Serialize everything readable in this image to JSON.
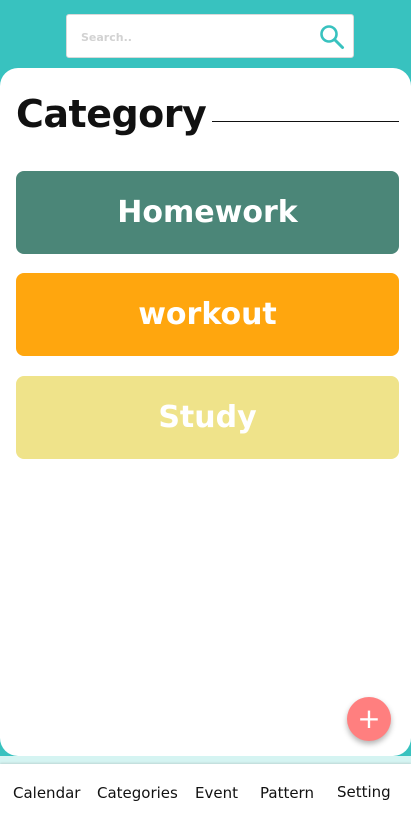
{
  "search": {
    "placeholder": "Search..",
    "value": ""
  },
  "icons": {
    "search": "search-icon",
    "fab": "plus-icon"
  },
  "main": {
    "title": "Category",
    "categories": [
      {
        "label": "Homework",
        "color": "#4b8678"
      },
      {
        "label": "workout",
        "color": "#ffa60e"
      },
      {
        "label": "Study",
        "color": "#efe38a"
      }
    ]
  },
  "fab": {
    "label": "+"
  },
  "nav": {
    "items": [
      {
        "label": "Calendar"
      },
      {
        "label": "Categories"
      },
      {
        "label": "Event"
      },
      {
        "label": "Pattern"
      },
      {
        "label": "Setting"
      }
    ]
  },
  "colors": {
    "background": "#38c2bf",
    "card": "#ffffff",
    "fab": "#ff7f7f",
    "search_icon": "#38c2bf"
  }
}
